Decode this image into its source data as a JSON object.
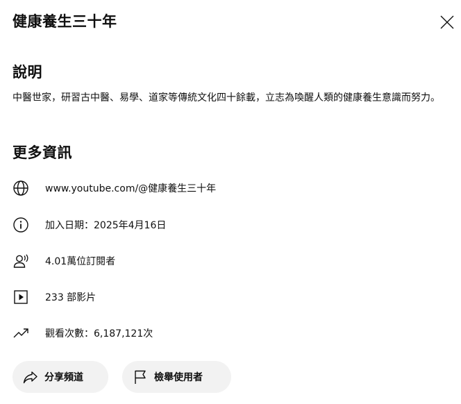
{
  "dialog": {
    "title": "健康養生三十年",
    "close_icon": "close-icon"
  },
  "description": {
    "heading": "說明",
    "text": "中醫世家，研習古中醫、易學、道家等傳統文化四十餘載，立志為喚醒人類的健康養生意識而努力。"
  },
  "more_info": {
    "heading": "更多資訊",
    "rows": [
      {
        "icon": "globe-icon",
        "text": "www.youtube.com/@健康養生三十年"
      },
      {
        "icon": "info-icon",
        "text": "加入日期：2025年4月16日"
      },
      {
        "icon": "subscribers-icon",
        "text": "4.01萬位訂閱者"
      },
      {
        "icon": "video-icon",
        "text": "233 部影片"
      },
      {
        "icon": "trending-icon",
        "text": "觀看次數：6,187,121次"
      }
    ]
  },
  "actions": {
    "share_label": "分享頻道",
    "share_icon": "share-icon",
    "report_label": "檢舉使用者",
    "report_icon": "flag-icon"
  }
}
